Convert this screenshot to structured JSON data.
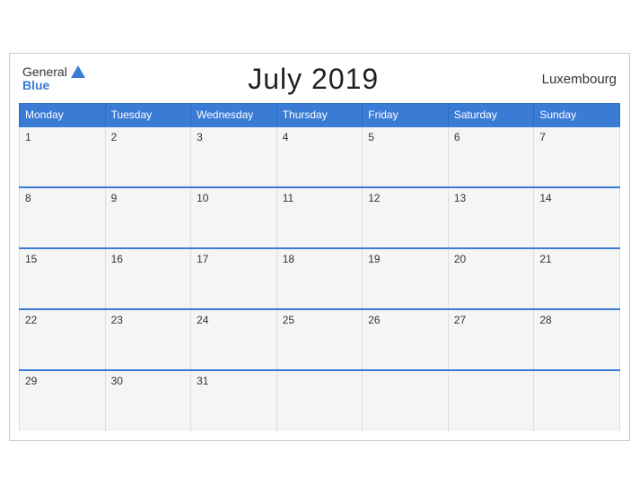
{
  "header": {
    "title": "July 2019",
    "country": "Luxembourg",
    "logo_general": "General",
    "logo_blue": "Blue"
  },
  "days_of_week": [
    "Monday",
    "Tuesday",
    "Wednesday",
    "Thursday",
    "Friday",
    "Saturday",
    "Sunday"
  ],
  "weeks": [
    [
      1,
      2,
      3,
      4,
      5,
      6,
      7
    ],
    [
      8,
      9,
      10,
      11,
      12,
      13,
      14
    ],
    [
      15,
      16,
      17,
      18,
      19,
      20,
      21
    ],
    [
      22,
      23,
      24,
      25,
      26,
      27,
      28
    ],
    [
      29,
      30,
      31,
      null,
      null,
      null,
      null
    ]
  ]
}
